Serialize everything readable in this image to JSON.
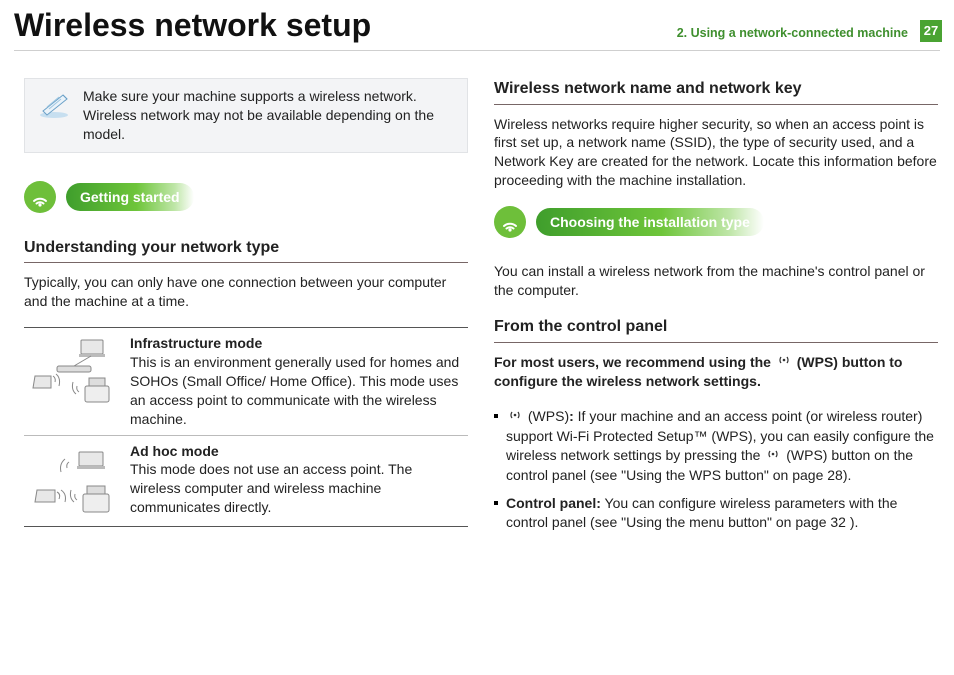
{
  "header": {
    "title": "Wireless network setup",
    "chapter": "2.  Using a network-connected machine",
    "page_number": "27"
  },
  "callout": {
    "text": "Make sure your machine supports a wireless network. Wireless network may not be available depending on the model."
  },
  "section_getting_started": "Getting started",
  "section_choosing": "Choosing the installation type",
  "sub_understanding": "Understanding your network type",
  "understanding_body": "Typically, you can only have one connection between your computer and the machine at a time.",
  "modes": {
    "infra_title": "Infrastructure mode",
    "infra_desc": "This is an environment generally used for homes and SOHOs (Small Office/ Home Office). This mode uses an access point to communicate with the wireless machine.",
    "adhoc_title": "Ad hoc mode",
    "adhoc_desc": "This mode does not use an access point. The wireless computer and wireless machine communicates directly."
  },
  "sub_netname": "Wireless network name and network key",
  "netname_body": "Wireless networks require higher security, so when an access point is first set up, a network name (SSID), the type of security used, and a Network Key are created for the network. Locate this information before proceeding with the machine installation.",
  "choosing_body": "You can install a wireless network from the machine's control panel or the computer.",
  "sub_controlpanel": "From the control panel",
  "recommend_prefix": "For most users, we recommend using the ",
  "recommend_suffix": " (WPS) button to configure the wireless network settings.",
  "bullet_wps_label": " (WPS)",
  "bullet_wps_colon": ": ",
  "bullet_wps_text_a": "If your machine and an access point (or wireless router) support Wi-Fi Protected Setup™ (WPS), you can easily configure the wireless network settings by pressing the ",
  "bullet_wps_text_b": " (WPS) button on the control panel (see \"Using the WPS button\" on page 28).",
  "bullet_cp_label": "Control panel:",
  "bullet_cp_text": " You can configure wireless parameters with the control panel (see \"Using the menu button\" on page 32 )."
}
